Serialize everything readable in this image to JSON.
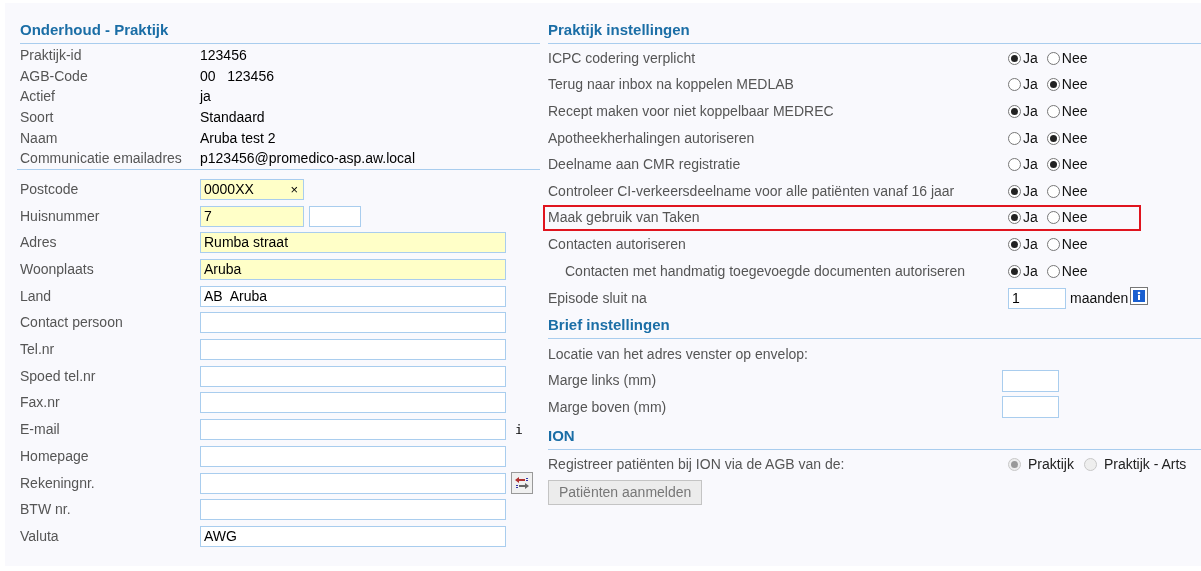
{
  "practice": {
    "title": "Onderhoud - Praktijk",
    "info": [
      {
        "label": "Praktijk-id",
        "value": "123456"
      },
      {
        "label": "AGB-Code",
        "value": "00   123456"
      },
      {
        "label": "Actief",
        "value": "ja"
      },
      {
        "label": "Soort",
        "value": "Standaard"
      },
      {
        "label": "Naam",
        "value": "Aruba test 2"
      },
      {
        "label": "Communicatie emailadres",
        "value": "p123456@promedico-asp.aw.local"
      }
    ],
    "fields": [
      {
        "kind": "clearable",
        "label": "Postcode",
        "value": "0000XX",
        "required": true,
        "clear": "×"
      },
      {
        "kind": "split",
        "label": "Huisnummer",
        "value": "7",
        "required": true
      },
      {
        "kind": "text",
        "label": "Adres",
        "value": "Rumba straat",
        "required": true
      },
      {
        "kind": "text",
        "label": "Woonplaats",
        "value": "Aruba",
        "required": true
      },
      {
        "kind": "text",
        "label": "Land",
        "value": "AB  Aruba",
        "required": false
      },
      {
        "kind": "text",
        "label": "Contact persoon",
        "required": false
      },
      {
        "kind": "text",
        "label": "Tel.nr",
        "required": false
      },
      {
        "kind": "text",
        "label": "Spoed tel.nr",
        "required": false
      },
      {
        "kind": "text",
        "label": "Fax.nr",
        "required": false
      },
      {
        "kind": "hint",
        "label": "E-mail",
        "required": false,
        "hint": "i"
      },
      {
        "kind": "text",
        "label": "Homepage",
        "required": false
      },
      {
        "kind": "action",
        "label": "Rekeningnr.",
        "required": false
      },
      {
        "kind": "text",
        "label": "BTW nr.",
        "required": false
      },
      {
        "kind": "text",
        "label": "Valuta",
        "value": "AWG",
        "required": false
      }
    ]
  },
  "settings": {
    "title": "Praktijk instellingen",
    "rows": [
      {
        "label": "ICPC codering verplicht",
        "highlighted": false,
        "options": [
          {
            "label": "Ja",
            "selected": true
          },
          {
            "label": "Nee",
            "selected": false
          }
        ]
      },
      {
        "label": "Terug naar inbox na koppelen MEDLAB",
        "highlighted": false,
        "options": [
          {
            "label": "Ja",
            "selected": false
          },
          {
            "label": "Nee",
            "selected": true
          }
        ]
      },
      {
        "label": "Recept maken voor niet koppelbaar MEDREC",
        "highlighted": false,
        "options": [
          {
            "label": "Ja",
            "selected": true
          },
          {
            "label": "Nee",
            "selected": false
          }
        ]
      },
      {
        "label": "Apotheekherhalingen autoriseren",
        "highlighted": false,
        "options": [
          {
            "label": "Ja",
            "selected": false
          },
          {
            "label": "Nee",
            "selected": true
          }
        ]
      },
      {
        "label": "Deelname aan CMR registratie",
        "highlighted": false,
        "options": [
          {
            "label": "Ja",
            "selected": false
          },
          {
            "label": "Nee",
            "selected": true
          }
        ]
      },
      {
        "label": "Controleer CI-verkeersdeelname voor alle patiënten vanaf 16 jaar",
        "highlighted": false,
        "options": [
          {
            "label": "Ja",
            "selected": true
          },
          {
            "label": "Nee",
            "selected": false
          }
        ]
      },
      {
        "label": "Maak gebruik van Taken",
        "highlighted": true,
        "options": [
          {
            "label": "Ja",
            "selected": true
          },
          {
            "label": "Nee",
            "selected": false
          }
        ]
      },
      {
        "label": "Contacten autoriseren",
        "highlighted": false,
        "options": [
          {
            "label": "Ja",
            "selected": true
          },
          {
            "label": "Nee",
            "selected": false
          }
        ],
        "children": [
          {
            "label": "Contacten met handmatig toegevoegde documenten autoriseren",
            "highlighted": false,
            "options": [
              {
                "label": "Ja",
                "selected": true
              },
              {
                "label": "Nee",
                "selected": false
              }
            ]
          }
        ]
      }
    ],
    "episode": {
      "label": "Episode sluit na",
      "value": "1",
      "unit": "maanden"
    }
  },
  "letter": {
    "title": "Brief instellingen",
    "note": "Locatie van het adres venster op envelop:",
    "fields": [
      {
        "label": "Marge links (mm)"
      },
      {
        "label": "Marge boven (mm)"
      }
    ]
  },
  "ion": {
    "title": "ION",
    "label": "Registreer patiënten bij ION via de AGB van de:",
    "disabled": true,
    "options": [
      {
        "label": "Praktijk",
        "selected": true
      },
      {
        "label": "Praktijk - Arts",
        "selected": false
      }
    ],
    "button": {
      "label": "Patiënten aanmelden",
      "disabled": true
    }
  }
}
